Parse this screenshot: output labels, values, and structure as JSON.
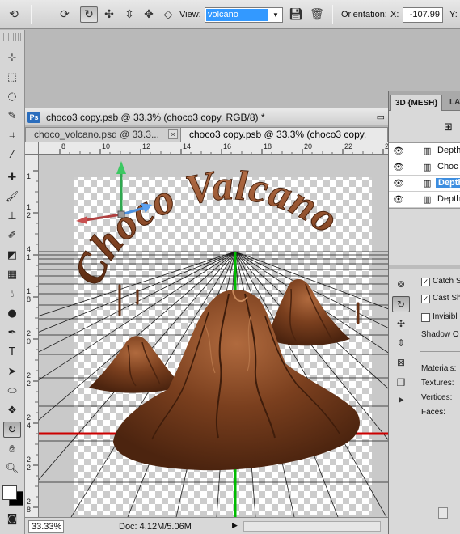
{
  "options_bar": {
    "view_label": "View:",
    "view_value": "volcano",
    "orientation_label": "Orientation:",
    "x_label": "X:",
    "x_value": "-107.99",
    "y_label": "Y:",
    "icons": [
      "rotate-3d-icon",
      "roll-3d-icon",
      "drag-3d-icon",
      "slide-3d-icon",
      "scale-3d-icon",
      "camera-3d-icon",
      "save-view-icon",
      "delete-view-icon"
    ]
  },
  "document": {
    "ps_badge": "Ps",
    "title": "choco3 copy.psb @ 33.3% (choco3 copy, RGB/8) *",
    "tabs": [
      {
        "label": "choco_volcano.psd @ 33.3...",
        "close": "×"
      },
      {
        "label": "choco3 copy.psb @ 33.3% (choco3 copy, RGB/8",
        "close": "×"
      }
    ],
    "ruler_top": [
      "8",
      "10",
      "12",
      "14",
      "16",
      "18",
      "20",
      "22",
      "24"
    ],
    "ruler_left": [
      "1",
      "1",
      "2",
      "4",
      "1",
      "1",
      "8",
      "2",
      "0",
      "2",
      "2",
      "2",
      "4",
      "2",
      "2",
      "2",
      "8"
    ],
    "zoom": "33.33%",
    "doc_info": "Doc: 4.12M/5.06M",
    "artwork_text": "Choco Valcano"
  },
  "panel3d": {
    "tabs": [
      "3D {MESH}",
      "LAY"
    ],
    "layers": [
      {
        "name": "Depth",
        "selected": false
      },
      {
        "name": "Choc",
        "selected": false
      },
      {
        "name": "Depth",
        "selected": true
      },
      {
        "name": "Depth",
        "selected": false
      }
    ],
    "options": [
      {
        "label": "Catch S",
        "checked": true
      },
      {
        "label": "Cast Sha",
        "checked": true
      },
      {
        "label": "Invisibl",
        "checked": false
      }
    ],
    "shadow_opacity_label": "Shadow O",
    "stats": [
      "Materials:",
      "Textures:",
      "Vertices:",
      "Faces:"
    ]
  },
  "colors": {
    "accent": "#3399ff",
    "chocolate": "#7a3f1e",
    "axis_red": "#cc0000",
    "axis_green": "#00bb00"
  }
}
